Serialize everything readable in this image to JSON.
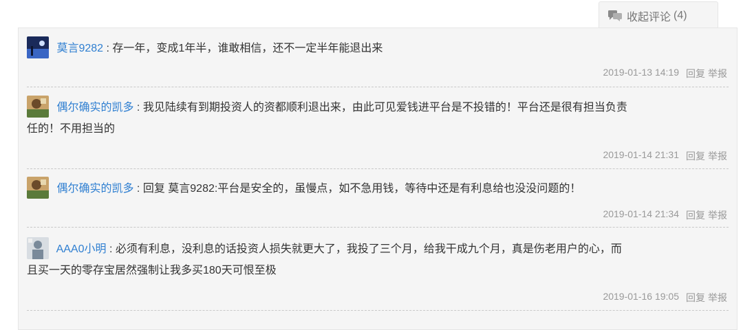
{
  "toggle": {
    "label": "收起评论",
    "count": "(4)",
    "icon": "chat-bubbles-icon"
  },
  "comments": [
    {
      "user": "莫言9282",
      "colon": ":",
      "text": "存一年，变成1年半，谁敢相信，还不一定半年能退出来",
      "time": "2019-01-13 14:19",
      "reply": "回复",
      "report": "举报",
      "avatar_colors": [
        "#1a2a5a",
        "#3a66c4"
      ]
    },
    {
      "user": "偶尔确实的凯多",
      "colon": ":",
      "text_line1": "我见陆续有到期投资人的资都顺利退出来，由此可见爱钱进平台是不投错的！平台还是很有担当负责",
      "text_line2": "任的！不用担当的",
      "time": "2019-01-14 21:31",
      "reply": "回复",
      "report": "举报",
      "avatar_colors": [
        "#5a7a3a",
        "#c9a36a"
      ]
    },
    {
      "user": "偶尔确实的凯多",
      "colon": ":",
      "text": "回复 莫言9282:平台是安全的，虽慢点，如不急用钱，等待中还是有利息给也没没问题的！",
      "time": "2019-01-14 21:34",
      "reply": "回复",
      "report": "举报",
      "avatar_colors": [
        "#5a7a3a",
        "#c9a36a"
      ]
    },
    {
      "user": "AAA0小明",
      "colon": ":",
      "text_line1": "必须有利息，没利息的话投资人损失就更大了，我投了三个月，给我干成九个月，真是伤老用户的心，而",
      "text_line2": "且买一天的零存宝居然强制让我多买180天可恨至极",
      "time": "2019-01-16 19:05",
      "reply": "回复",
      "report": "举报",
      "avatar_colors": [
        "#d8dde2",
        "#7a8a9a"
      ]
    }
  ]
}
